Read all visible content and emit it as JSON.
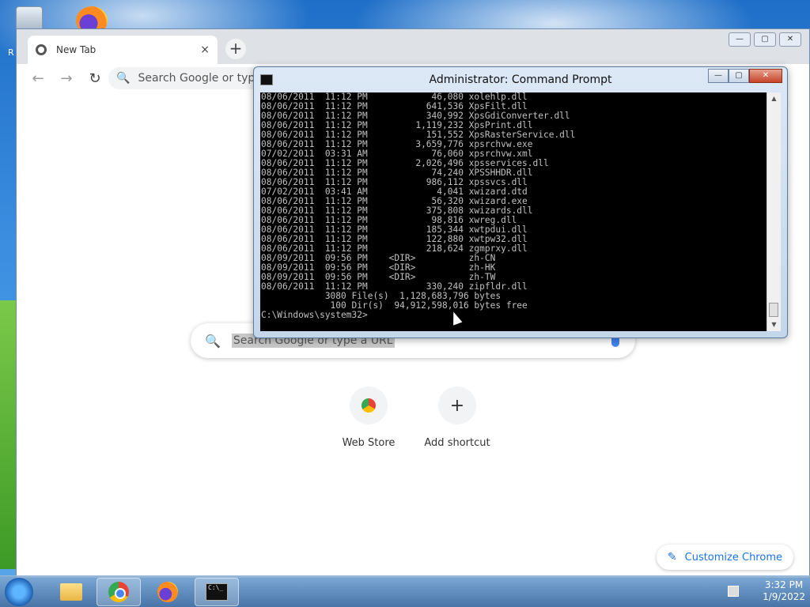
{
  "desktop": {
    "recycle_label": "R"
  },
  "browser": {
    "tab_title": "New Tab",
    "tab_close": "×",
    "new_tab": "+",
    "window_controls": {
      "minimize": "—",
      "maximize": "▢",
      "close": "✕"
    },
    "nav": {
      "back": "←",
      "forward": "→",
      "reload": "↻"
    },
    "omnibox_text": "Search Google or type a",
    "search_placeholder": "Search Google or type a URL",
    "shortcuts": [
      {
        "label": "Web Store"
      },
      {
        "label": "Add shortcut",
        "icon": "+"
      }
    ],
    "customize_label": "Customize Chrome"
  },
  "cmd": {
    "title": "Administrator: Command Prompt",
    "controls": {
      "minimize": "—",
      "maximize": "▢",
      "close": "✕"
    },
    "lines": [
      "08/06/2011  11:12 PM            46,080 xolehlp.dll",
      "08/06/2011  11:12 PM           641,536 XpsFilt.dll",
      "08/06/2011  11:12 PM           340,992 XpsGdiConverter.dll",
      "08/06/2011  11:12 PM         1,119,232 XpsPrint.dll",
      "08/06/2011  11:12 PM           151,552 XpsRasterService.dll",
      "08/06/2011  11:12 PM         3,659,776 xpsrchvw.exe",
      "07/02/2011  03:31 AM            76,060 xpsrchvw.xml",
      "08/06/2011  11:12 PM         2,026,496 xpsservices.dll",
      "08/06/2011  11:12 PM            74,240 XPSSHHDR.dll",
      "08/06/2011  11:12 PM           986,112 xpssvcs.dll",
      "07/02/2011  03:41 AM             4,041 xwizard.dtd",
      "08/06/2011  11:12 PM            56,320 xwizard.exe",
      "08/06/2011  11:12 PM           375,808 xwizards.dll",
      "08/06/2011  11:12 PM            98,816 xwreg.dll",
      "08/06/2011  11:12 PM           185,344 xwtpdui.dll",
      "08/06/2011  11:12 PM           122,880 xwtpw32.dll",
      "08/06/2011  11:12 PM           218,624 zgmprxy.dll",
      "08/09/2011  09:56 PM    <DIR>          zh-CN",
      "08/09/2011  09:56 PM    <DIR>          zh-HK",
      "08/09/2011  09:56 PM    <DIR>          zh-TW",
      "08/06/2011  11:12 PM           330,240 zipfldr.dll",
      "            3080 File(s)  1,128,683,796 bytes",
      "             100 Dir(s)  94,912,598,016 bytes free",
      "",
      "C:\\Windows\\system32>"
    ],
    "scroll_up": "▲",
    "scroll_down": "▼"
  },
  "taskbar": {
    "cmd_icon_text": "C:\\_",
    "clock_time": "3:32 PM",
    "clock_date": "1/9/2022"
  }
}
